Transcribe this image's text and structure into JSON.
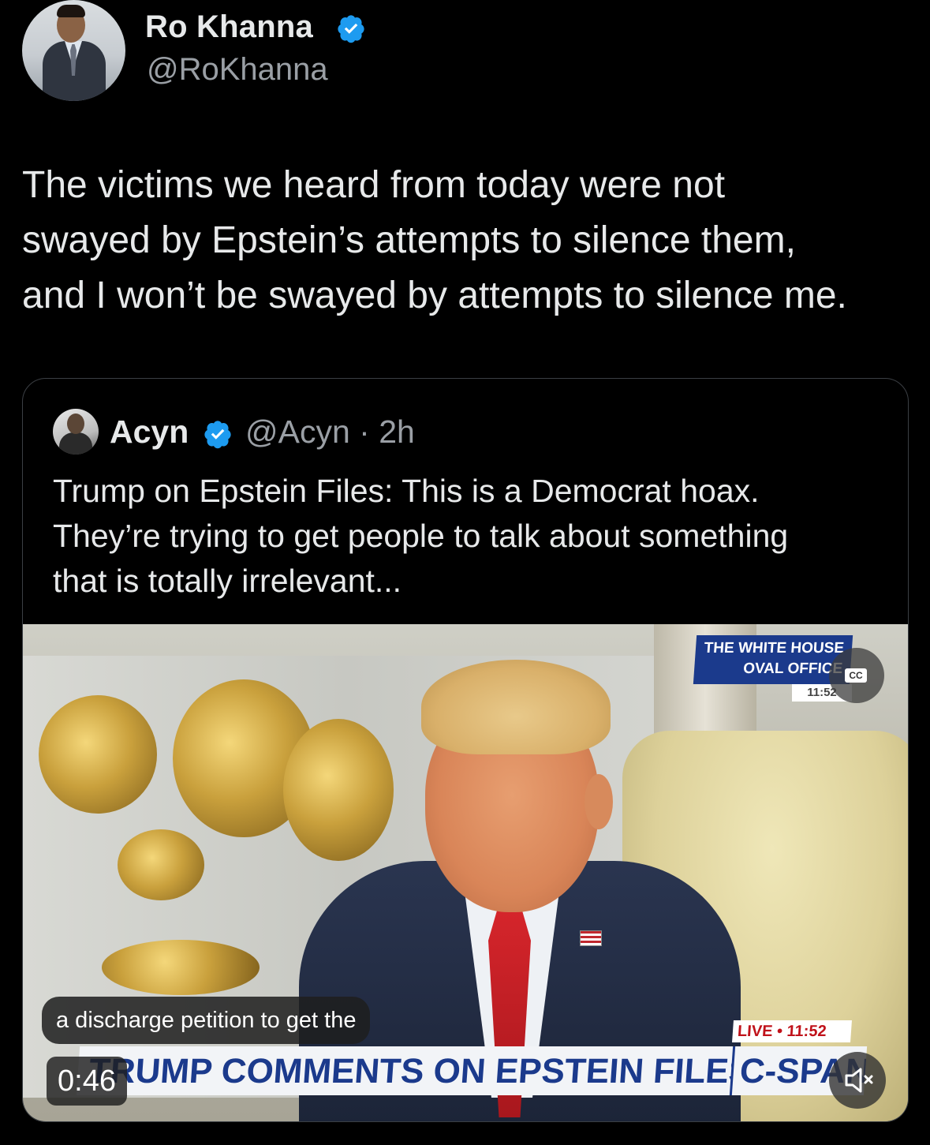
{
  "tweet": {
    "author_name": "Ro Khanna",
    "author_handle": "@RoKhanna",
    "text": "The victims we heard from today were not\nswayed by Epstein’s attempts to silence them,\nand I won’t be swayed by attempts to silence me."
  },
  "quoted": {
    "author_name": "Acyn",
    "author_handle": "@Acyn · 2h",
    "text": "Trump on Epstein Files: This is a Democrat hoax.\nThey’re trying to get people to talk about something\nthat is totally irrelevant..."
  },
  "video": {
    "bug_line1": "THE WHITE HOUSE",
    "bug_line2": "OVAL OFFICE",
    "bug_time": "11:52",
    "cc_label": "CC",
    "caption": "a discharge petition to get the",
    "live_tag": "LIVE • 11:52",
    "lower_third": "TRUMP COMMENTS ON EPSTEIN FILES",
    "network": "C-SPAN",
    "timestamp": "0:46"
  },
  "colors": {
    "background": "#000000",
    "text": "#e7e9ea",
    "secondary_text": "#9a9fa5",
    "verified": "#1d9bf0",
    "cspan_blue": "#1b3a8c"
  },
  "icons": [
    "verified-badge-icon",
    "closed-captions-icon",
    "mute-icon"
  ]
}
